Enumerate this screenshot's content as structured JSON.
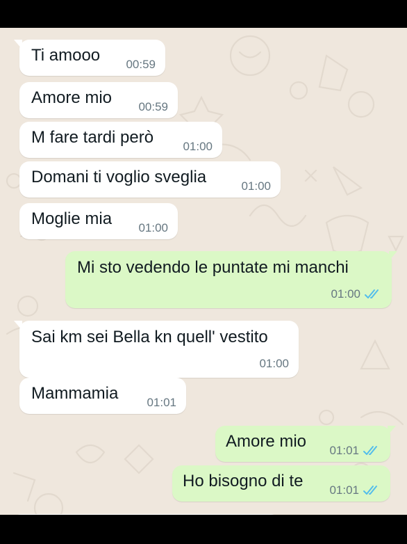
{
  "conversation": {
    "messages": [
      {
        "direction": "in",
        "text": "Ti amooo",
        "time": "00:59"
      },
      {
        "direction": "in",
        "text": "Amore mio",
        "time": "00:59"
      },
      {
        "direction": "in",
        "text": "M fare tardi però",
        "time": "01:00"
      },
      {
        "direction": "in",
        "text": "Domani ti voglio sveglia",
        "time": "01:00"
      },
      {
        "direction": "in",
        "text": "Moglie mia",
        "time": "01:00"
      },
      {
        "direction": "out",
        "text": "Mi sto vedendo le puntate mi manchi",
        "time": "01:00",
        "status": "read",
        "status_icon": "double-check-icon"
      },
      {
        "direction": "in",
        "text": "Sai km sei Bella kn quell' vestito",
        "time": "01:00"
      },
      {
        "direction": "in",
        "text": "Mammamia",
        "time": "01:01"
      },
      {
        "direction": "out",
        "text": "Amore mio",
        "time": "01:01",
        "status": "read",
        "status_icon": "double-check-icon"
      },
      {
        "direction": "out",
        "text": "Ho bisogno di te",
        "time": "01:01",
        "status": "read",
        "status_icon": "double-check-icon"
      }
    ]
  },
  "colors": {
    "chat_background": "#efe7dd",
    "incoming_bubble": "#ffffff",
    "outgoing_bubble": "#dbf8c6",
    "read_ticks": "#53bdeb",
    "timestamp": "#667781"
  }
}
